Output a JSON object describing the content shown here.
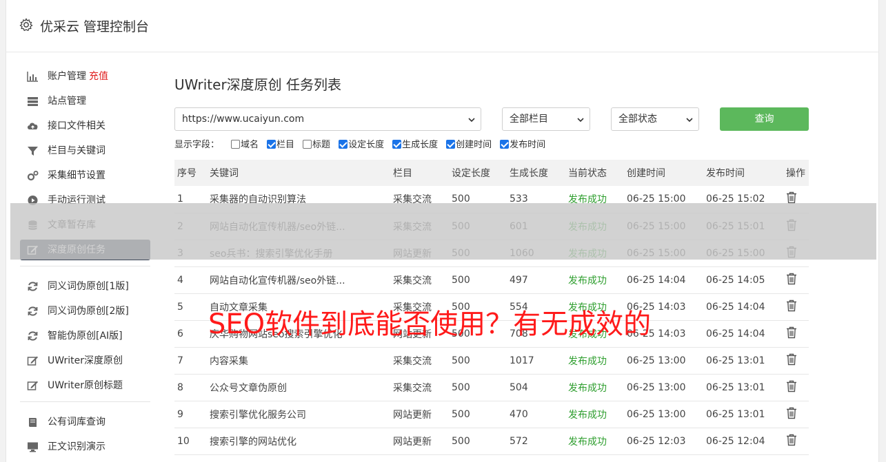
{
  "header": {
    "title": "优采云 管理控制台"
  },
  "sidebar": {
    "account_label": "账户管理",
    "recharge_label": "充值",
    "group1": [
      {
        "label": "站点管理",
        "icon": "server-icon"
      },
      {
        "label": "接口文件相关",
        "icon": "cloud-upload-icon"
      },
      {
        "label": "栏目与关键词",
        "icon": "filter-icon"
      },
      {
        "label": "采集细节设置",
        "icon": "gears-icon"
      },
      {
        "label": "手动运行测试",
        "icon": "play-circle-icon"
      },
      {
        "label": "文章暂存库",
        "icon": "database-icon"
      },
      {
        "label": "深度原创任务",
        "icon": "edit-icon"
      }
    ],
    "group2": [
      {
        "label": "同义词伪原创[1版]",
        "icon": "refresh-icon"
      },
      {
        "label": "同义词伪原创[2版]",
        "icon": "refresh-icon"
      },
      {
        "label": "智能伪原创[AI版]",
        "icon": "refresh-icon"
      },
      {
        "label": "UWriter深度原创",
        "icon": "edit-icon"
      },
      {
        "label": "UWriter原创标题",
        "icon": "edit-icon"
      }
    ],
    "group3": [
      {
        "label": "公有词库查询",
        "icon": "book-icon"
      },
      {
        "label": "正文识别演示",
        "icon": "monitor-icon"
      }
    ]
  },
  "main": {
    "title": "UWriter深度原创 任务列表",
    "site_select": "https://www.ucaiyun.com",
    "column_select": "全部栏目",
    "status_select": "全部状态",
    "query_label": "查询",
    "fields_label": "显示字段：",
    "fields": [
      {
        "label": "域名",
        "checked": false
      },
      {
        "label": "栏目",
        "checked": true
      },
      {
        "label": "标题",
        "checked": false
      },
      {
        "label": "设定长度",
        "checked": true
      },
      {
        "label": "生成长度",
        "checked": true
      },
      {
        "label": "创建时间",
        "checked": true
      },
      {
        "label": "发布时间",
        "checked": true
      }
    ],
    "columns": [
      "序号",
      "关键词",
      "栏目",
      "设定长度",
      "生成长度",
      "当前状态",
      "创建时间",
      "发布时间",
      "操作"
    ],
    "rows": [
      [
        "1",
        "采集器的自动识别算法",
        "采集交流",
        "500",
        "533",
        "发布成功",
        "06-25 15:00",
        "06-25 15:02"
      ],
      [
        "2",
        "网站自动化宣传机器/seo外链...",
        "采集交流",
        "500",
        "601",
        "发布成功",
        "06-25 15:00",
        "06-25 15:01"
      ],
      [
        "3",
        "seo兵书：搜索引擎优化手册",
        "网站更新",
        "500",
        "1060",
        "发布成功",
        "06-25 15:00",
        "06-25 15:00"
      ],
      [
        "4",
        "网站自动化宣传机器/seo外链...",
        "采集交流",
        "500",
        "497",
        "发布成功",
        "06-25 14:04",
        "06-25 14:05"
      ],
      [
        "5",
        "自动文章采集",
        "采集交流",
        "500",
        "554",
        "发布成功",
        "06-25 14:03",
        "06-25 14:04"
      ],
      [
        "6",
        "庆华购物网站seo搜索引擎优化",
        "网站更新",
        "500",
        "708",
        "发布成功",
        "06-25 14:03",
        "06-25 14:04"
      ],
      [
        "7",
        "内容采集",
        "采集交流",
        "500",
        "1017",
        "发布成功",
        "06-25 13:00",
        "06-25 13:01"
      ],
      [
        "8",
        "公众号文章伪原创",
        "采集交流",
        "500",
        "504",
        "发布成功",
        "06-25 13:00",
        "06-25 13:01"
      ],
      [
        "9",
        "搜索引擎优化服务公司",
        "网站更新",
        "500",
        "470",
        "发布成功",
        "06-25 13:00",
        "06-25 13:01"
      ],
      [
        "10",
        "搜索引擎的网站优化",
        "网站更新",
        "500",
        "572",
        "发布成功",
        "06-25 12:03",
        "06-25 12:04"
      ]
    ]
  },
  "overlay": {
    "text": "SEO软件到底能否使用？有无成效的"
  },
  "colors": {
    "accent_green": "#5cb85c",
    "success_text": "#2e9e2e",
    "active_nav": "#3b4556",
    "overlay_red": "#ff1a1a",
    "recharge_red": "#e02020"
  }
}
